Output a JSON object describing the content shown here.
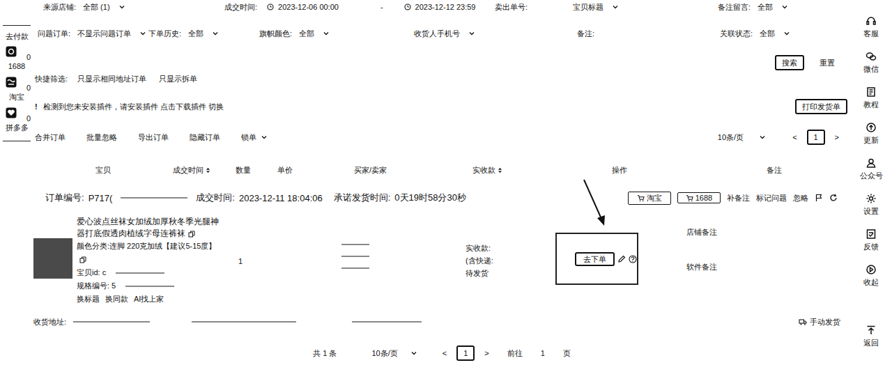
{
  "left_sidebar": {
    "title": "去付款",
    "platforms": [
      {
        "label": "1688",
        "count": "0"
      },
      {
        "label": "淘宝",
        "count": "0"
      },
      {
        "label": "拼多多",
        "count": "0"
      }
    ]
  },
  "filters": {
    "rows": [
      [
        {
          "kind": "select",
          "label": "来源店铺:",
          "value": "全部 (1)"
        },
        {
          "kind": "daterange",
          "label": "成交时间:",
          "start": "2023-12-06 00:00",
          "separator": "-",
          "end": "2023-12-12 23:59"
        },
        {
          "kind": "input",
          "label": "卖出单号:"
        },
        {
          "kind": "select",
          "label": "",
          "value": "宝贝标题"
        },
        {
          "kind": "select",
          "label": "备注留言:",
          "value": "全部"
        }
      ],
      [
        {
          "kind": "select",
          "label": "问题订单:",
          "value": "不显示问题订单"
        },
        {
          "kind": "select",
          "label": "下单历史:",
          "value": "全部"
        },
        {
          "kind": "select",
          "label": "旗帜颜色:",
          "value": "全部"
        },
        {
          "kind": "select",
          "label": "",
          "value": "收货人手机号"
        },
        {
          "kind": "input",
          "label": "备注:"
        },
        {
          "kind": "select",
          "label": "关联状态:",
          "value": "全部"
        }
      ]
    ],
    "search_button": "搜索",
    "reset_button": "重置"
  },
  "quick_filter": {
    "label": "快捷筛选:",
    "options": [
      "只显示相同地址订单",
      "只显示拆单"
    ]
  },
  "plugin_notice": {
    "icon": "!",
    "text": "检测到您未安装插件，请安装插件 点击下载插件 切换",
    "button": "打印发货单"
  },
  "toolbar": {
    "actions": [
      "合并订单",
      "批量忽略",
      "导出订单",
      "隐藏订单"
    ],
    "lock": "锁单",
    "page_size": "10条/页",
    "prev": "<",
    "page": "1",
    "next": ">"
  },
  "table": {
    "columns": [
      {
        "label": "宝贝",
        "sortable": false
      },
      {
        "label": "成交时间",
        "sortable": true
      },
      {
        "label": "数量",
        "sortable": false
      },
      {
        "label": "单价",
        "sortable": false
      },
      {
        "label": "买家/卖家",
        "sortable": false
      },
      {
        "label": "实收款",
        "sortable": true
      },
      {
        "label": "操作",
        "sortable": false
      },
      {
        "label": "备注",
        "sortable": false
      }
    ]
  },
  "orders": [
    {
      "number_label": "订单编号:",
      "number": "P717(",
      "time_label": "成交时间:",
      "time": "2023-12-11 18:04:06",
      "promise_label": "承诺发货时间:",
      "promise": "0天19时58分30秒",
      "platform_buttons": [
        "淘宝",
        "1688"
      ],
      "actions": [
        "补备注",
        "标记问题",
        "忽略"
      ],
      "title": "爱心波点丝袜女加绒加厚秋冬季光腿神器打底假透肉植绒字母连裤袜",
      "sku": "颜色分类:连脚 220克加绒【建议5-15度】",
      "id_label": "宝贝id:",
      "id": "c",
      "spec_label": "规格编号:",
      "spec": "5",
      "links": [
        "换标题",
        "换同款",
        "AI找上家"
      ],
      "quantity": "1",
      "received_label": "实收款:",
      "shipping_label": "(含快递:",
      "status": "待发货",
      "order_button": "去下单",
      "highlighted": true,
      "remarks": [
        "店铺备注",
        "软件备注"
      ],
      "address_label": "收货地址:",
      "manual_ship": "手动发货"
    }
  ],
  "pagination": {
    "total": "共 1 条",
    "page_size": "10条/页",
    "prev": "<",
    "page": "1",
    "next": ">",
    "goto_label": "前往",
    "goto_value": "1",
    "page_unit": "页"
  },
  "right_sidebar": [
    {
      "label": "客服"
    },
    {
      "label": "微信"
    },
    {
      "label": "教程"
    },
    {
      "label": "更新"
    },
    {
      "label": "公众号"
    },
    {
      "label": "设置"
    },
    {
      "label": "反馈"
    },
    {
      "label": "收起"
    },
    {
      "label": "返回"
    }
  ]
}
